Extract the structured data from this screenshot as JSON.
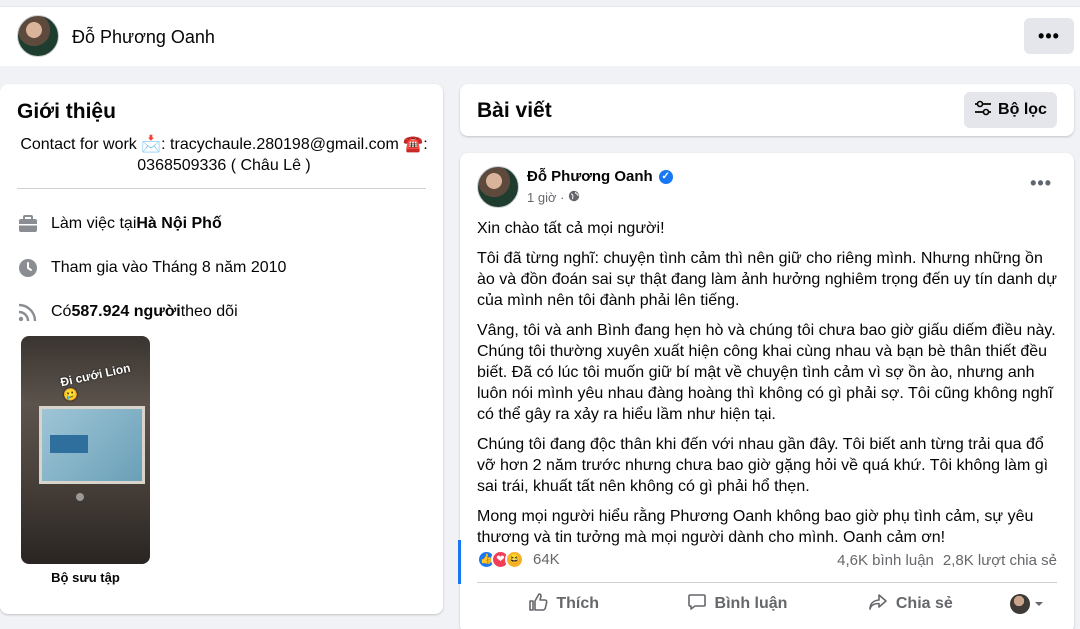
{
  "profile": {
    "name": "Đỗ Phương Oanh",
    "more_label": "•••"
  },
  "intro": {
    "title": "Giới thiệu",
    "contact_line1": "Contact for work 📩: tracychaule.280198@gmail.com ☎️:",
    "contact_line2": "0368509336 ( Châu Lê )",
    "work_prefix": "Làm việc tại ",
    "work_place": "Hà Nội Phố",
    "joined": "Tham gia vào Tháng 8 năm 2010",
    "followers_prefix": "Có ",
    "followers_count": "587.924 người",
    "followers_suffix": " theo dõi",
    "photo_caption": "Đi cưới Lion 🥲",
    "collection_label": "Bộ sưu tập"
  },
  "posts_header": {
    "title": "Bài viết",
    "filter_label": "Bộ lọc"
  },
  "post": {
    "author": "Đỗ Phương Oanh",
    "time": "1 giờ ·",
    "more_label": "•••",
    "paragraphs": [
      "Xin chào tất cả mọi người!",
      "Tôi đã từng nghĩ: chuyện tình cảm thì nên giữ cho riêng mình. Nhưng những ồn ào và đồn đoán sai sự thật đang làm ảnh hưởng nghiêm trọng đến uy tín danh dự của mình nên tôi đành phải lên tiếng.",
      "Vâng, tôi và anh Bình đang hẹn hò và chúng tôi chưa bao giờ giấu diếm điều này. Chúng tôi thường xuyên xuất hiện công khai cùng nhau và bạn bè thân thiết đều biết. Đã có lúc tôi muốn giữ bí mật về chuyện tình cảm vì sợ ồn ào, nhưng anh luôn nói mình yêu nhau đàng hoàng thì không có gì phải sợ. Tôi cũng không nghĩ có thể gây ra xảy ra hiểu lầm như hiện tại.",
      "Chúng tôi đang độc thân khi đến với nhau gần đây. Tôi biết anh từng trải qua đổ vỡ hơn 2 năm trước nhưng chưa bao giờ gặng hỏi về quá khứ. Tôi không làm gì sai trái, khuất tất nên không có gì phải hổ thẹn.",
      " Mong mọi người hiểu rằng Phương Oanh không bao giờ phụ tình cảm, sự yêu thương và tin tưởng mà mọi người dành cho mình. Oanh cảm ơn!"
    ],
    "reaction_count": "64K",
    "comments": "4,6K bình luận",
    "shares": "2,8K lượt chia sẻ",
    "like_label": "Thích",
    "comment_label": "Bình luận",
    "share_label": "Chia sẻ"
  },
  "colors": {
    "accent": "#1877f2",
    "muted": "#65676b",
    "background": "#f0f2f5"
  }
}
